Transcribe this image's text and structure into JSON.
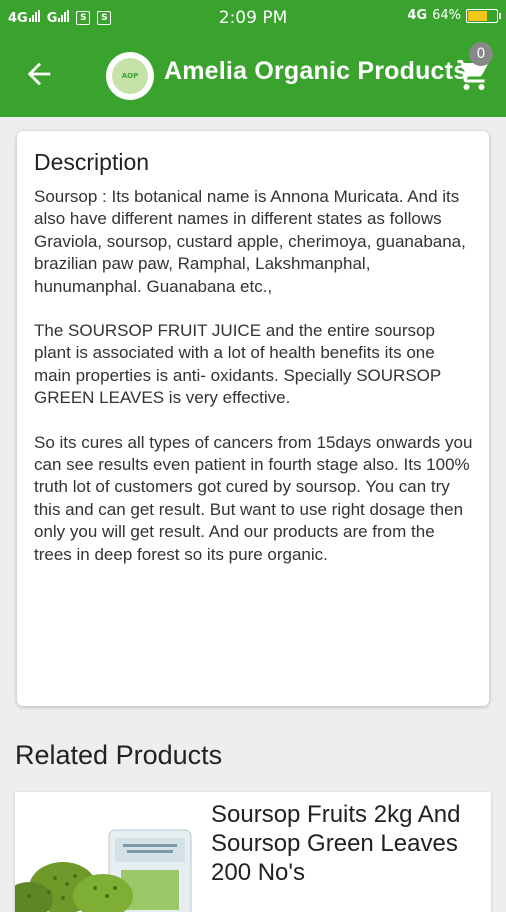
{
  "status_bar": {
    "left_signal_1": "4G",
    "left_signal_2": "G",
    "time": "2:09 PM",
    "network": "4G",
    "battery": "64%",
    "battery_level": 0.64
  },
  "app_bar": {
    "title": "Amelia Organic Products",
    "logo_text": "AOP",
    "cart_count": "0",
    "colors": {
      "primary": "#3aa32e"
    }
  },
  "description": {
    "heading": "Description",
    "paragraphs": [
      "Soursop : Its botanical name is Annona Muricata. And its also have different names in different states as follows Graviola, soursop, custard apple, cherimoya, guanabana, brazilian paw paw, Ramphal, Lakshmanphal, hunumanphal. Guanabana etc.,",
      "The SOURSOP FRUIT JUICE and the entire soursop plant is associated with a lot of health benefits its one main properties is anti- oxidants. Specially SOURSOP GREEN LEAVES is very effective.",
      "So its cures all types of cancers from 15days onwards you can see results even patient in fourth stage also. Its 100% truth lot of customers got cured by soursop. You can try this and can get result. But want to use right dosage then only you will get result. And our products are from the trees in deep forest so its pure organic."
    ]
  },
  "related": {
    "heading": "Related Products",
    "products": [
      {
        "name": "Soursop Fruits 2kg And Soursop Green Leaves 200 No's"
      }
    ]
  }
}
